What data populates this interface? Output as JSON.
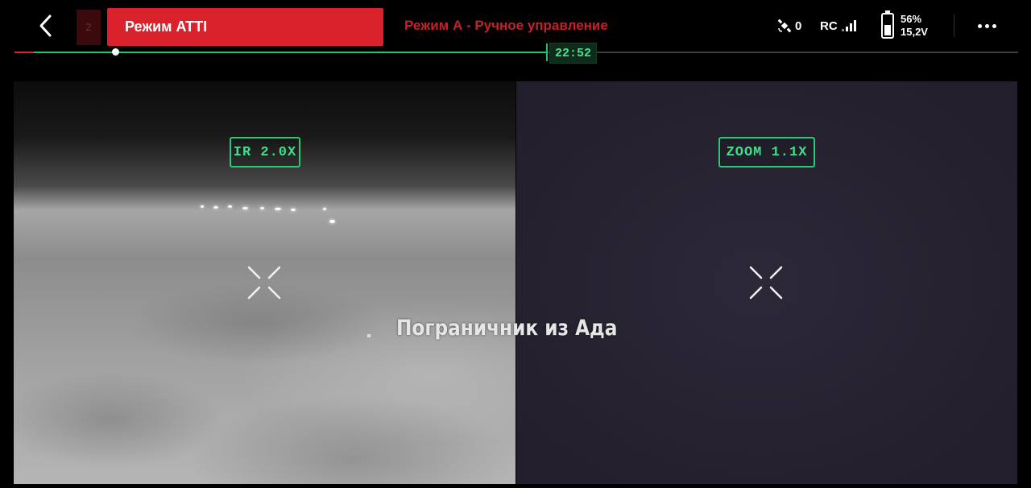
{
  "header": {
    "mode_index": "2",
    "flight_mode": "Режим ATTI",
    "mode_subtitle": "Режим А - Ручное управление"
  },
  "status": {
    "satellites": "0",
    "rc_label": "RC",
    "battery_percent": "56%",
    "battery_voltage": "15,2V"
  },
  "timeline": {
    "time": "22:52",
    "progress_fraction": 0.53,
    "playhead_fraction": 0.1
  },
  "camera": {
    "ir_label": "IR 2.0X",
    "zoom_label": "ZOOM 1.1X"
  },
  "overlay": {
    "watermark": "Пограничник из Ада"
  },
  "icons": [
    "back-chevron-icon",
    "satellite-icon",
    "signal-bars-icon",
    "battery-icon",
    "more-dots-icon",
    "crosshair-icon"
  ],
  "colors": {
    "accent_red": "#d9222c",
    "accent_green": "#1fc36b",
    "osd_green": "#3fe08a"
  }
}
